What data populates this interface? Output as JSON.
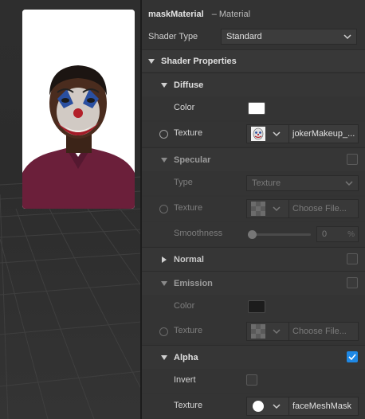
{
  "header": {
    "material_name": "maskMaterial",
    "type_label": "– Material"
  },
  "shader_type": {
    "label": "Shader Type",
    "value": "Standard"
  },
  "shader_properties": {
    "title": "Shader Properties"
  },
  "diffuse": {
    "title": "Diffuse",
    "color_label": "Color",
    "color_value": "#ffffff",
    "texture_label": "Texture",
    "texture_value": "jokerMakeup_..."
  },
  "specular": {
    "title": "Specular",
    "enabled": false,
    "type_label": "Type",
    "type_value": "Texture",
    "texture_label": "Texture",
    "texture_value": "Choose File...",
    "smoothness_label": "Smoothness",
    "smoothness_value": "0",
    "smoothness_unit": "%"
  },
  "normal": {
    "title": "Normal",
    "enabled": false
  },
  "emission": {
    "title": "Emission",
    "enabled": false,
    "color_label": "Color",
    "color_value": "#1c1c1c",
    "texture_label": "Texture",
    "texture_value": "Choose File..."
  },
  "alpha": {
    "title": "Alpha",
    "enabled": true,
    "invert_label": "Invert",
    "texture_label": "Texture",
    "texture_value": "faceMeshMask"
  },
  "colors": {
    "accent": "#1e88e5",
    "panel": "#333333",
    "section": "#383838"
  }
}
